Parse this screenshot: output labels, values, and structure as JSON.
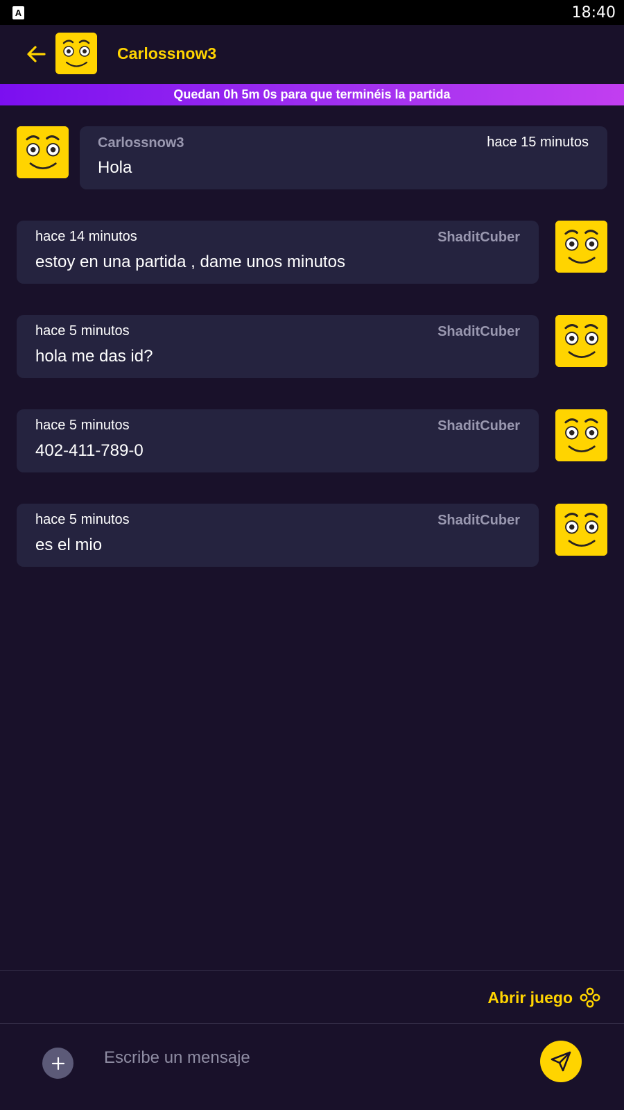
{
  "status_bar": {
    "time": "18:40",
    "app_icon": "A"
  },
  "header": {
    "title": "Carlossnow3",
    "back_icon": "arrow-left-icon"
  },
  "banner": {
    "text": "Quedan 0h 5m 0s para que terminéis la partida"
  },
  "messages": [
    {
      "sender": "Carlossnow3",
      "time": "hace 15 minutos",
      "text": "Hola",
      "side": "left"
    },
    {
      "sender": "ShaditCuber",
      "time": "hace 14 minutos",
      "text": "estoy en una partida , dame unos minutos",
      "side": "right"
    },
    {
      "sender": "ShaditCuber",
      "time": "hace 5 minutos",
      "text": "hola me das id?",
      "side": "right"
    },
    {
      "sender": "ShaditCuber",
      "time": "hace 5 minutos",
      "text": "402-411-789-0",
      "side": "right"
    },
    {
      "sender": "ShaditCuber",
      "time": "hace 5 minutos",
      "text": "es el mio",
      "side": "right"
    }
  ],
  "footer": {
    "open_game_label": "Abrir juego",
    "input_placeholder": "Escribe un mensaje"
  },
  "colors": {
    "background": "#19112a",
    "bubble": "#25233f",
    "accent": "#ffd400",
    "banner_start": "#7b0ff0",
    "banner_end": "#c23ef0"
  }
}
